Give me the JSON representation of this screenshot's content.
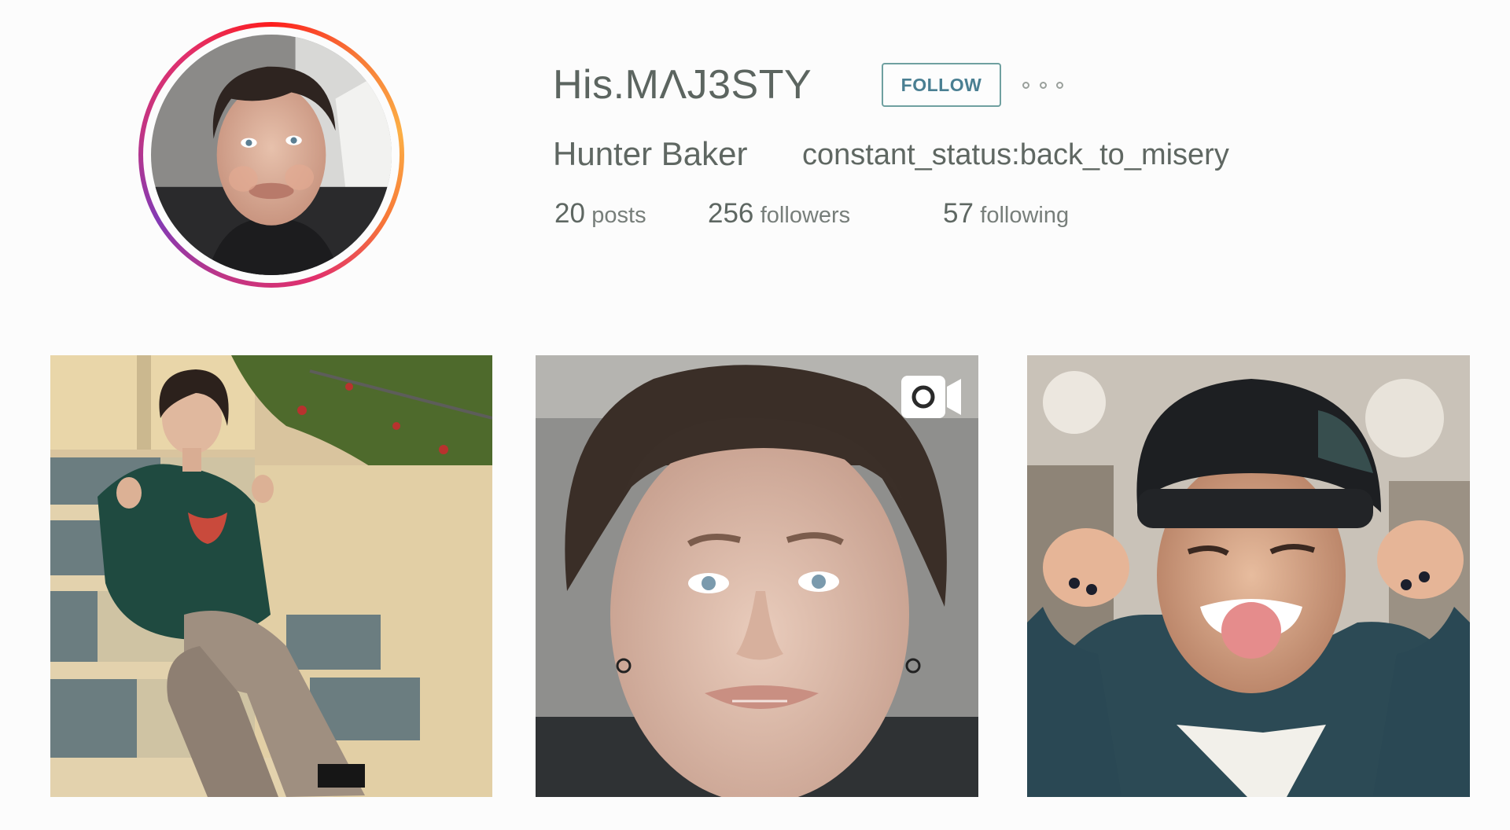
{
  "profile": {
    "username": "His.MΛJ3STY",
    "full_name": "Hunter Baker",
    "bio": "constant_status:back_to_misery",
    "follow_label": "FOLLOW",
    "more_icon": "more-horizontal-icon",
    "ring_colors": [
      "#c13584",
      "#e1306c",
      "#fd1d1d",
      "#f77737",
      "#fcaf45"
    ]
  },
  "stats": {
    "posts": {
      "count": "20",
      "label": "posts"
    },
    "followers": {
      "count": "256",
      "label": "followers"
    },
    "following": {
      "count": "57",
      "label": "following"
    }
  },
  "grid": {
    "posts": [
      {
        "type": "photo"
      },
      {
        "type": "video",
        "badge_icon": "video-camera-icon"
      },
      {
        "type": "photo"
      }
    ]
  },
  "colors": {
    "text": "#5c6560",
    "follow_border": "#6fa0a0",
    "follow_text": "#4a7f92",
    "background": "#fcfcfc"
  }
}
